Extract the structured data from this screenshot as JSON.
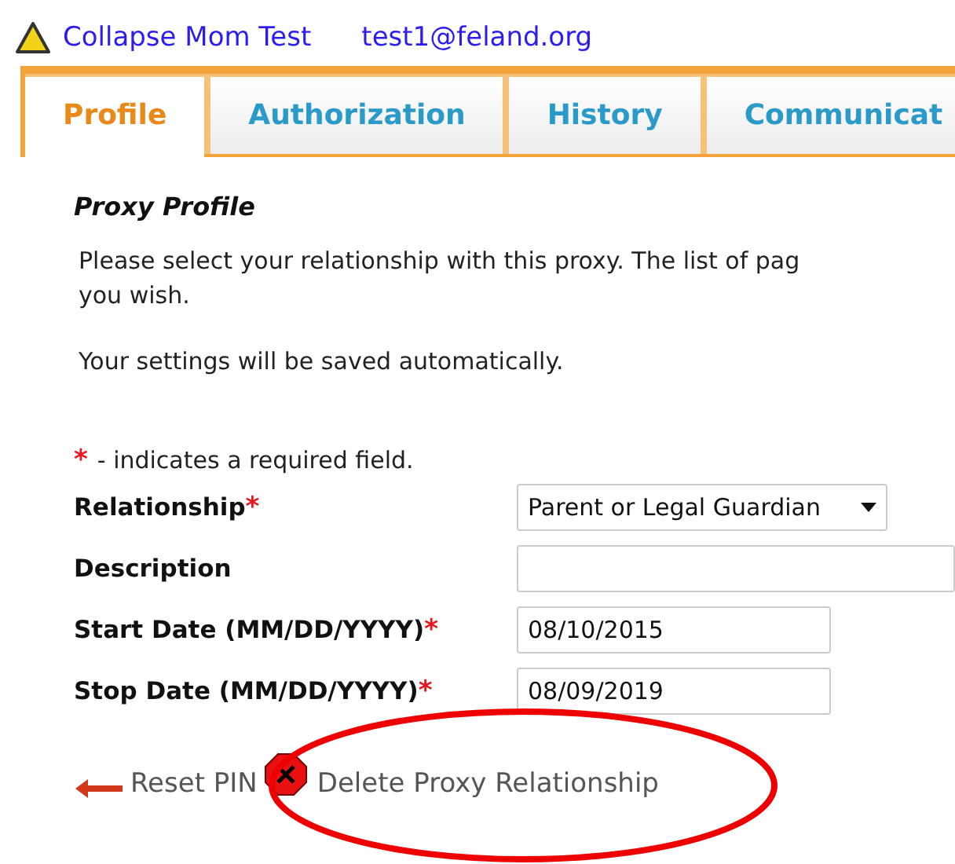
{
  "header": {
    "name": "Collapse Mom Test",
    "email": "test1@feland.org"
  },
  "tabs": [
    {
      "label": "Profile",
      "selected": true
    },
    {
      "label": "Authorization",
      "selected": false
    },
    {
      "label": "History",
      "selected": false
    },
    {
      "label": "Communicat",
      "selected": false
    }
  ],
  "section_title": "Proxy Profile",
  "intro_lines": [
    "Please select your relationship with this proxy. The list of pag",
    "you wish."
  ],
  "autosave_note": "Your settings will be saved automatically.",
  "required_note": {
    "mark": "*",
    "text": "- indicates a required field."
  },
  "fields": [
    {
      "kind": "select",
      "label": "Relationship",
      "required": true,
      "value": "Parent or Legal Guardian"
    },
    {
      "kind": "text",
      "label": "Description",
      "required": false
    },
    {
      "kind": "date",
      "label": "Start Date (MM/DD/YYYY)",
      "required": true,
      "value": "08/10/2015"
    },
    {
      "kind": "date",
      "label": "Stop Date (MM/DD/YYYY)",
      "required": true,
      "value": "08/09/2019"
    }
  ],
  "actions": [
    {
      "kind": "reset",
      "label": "Reset PIN"
    },
    {
      "kind": "delete",
      "label": "Delete Proxy Relationship"
    }
  ]
}
